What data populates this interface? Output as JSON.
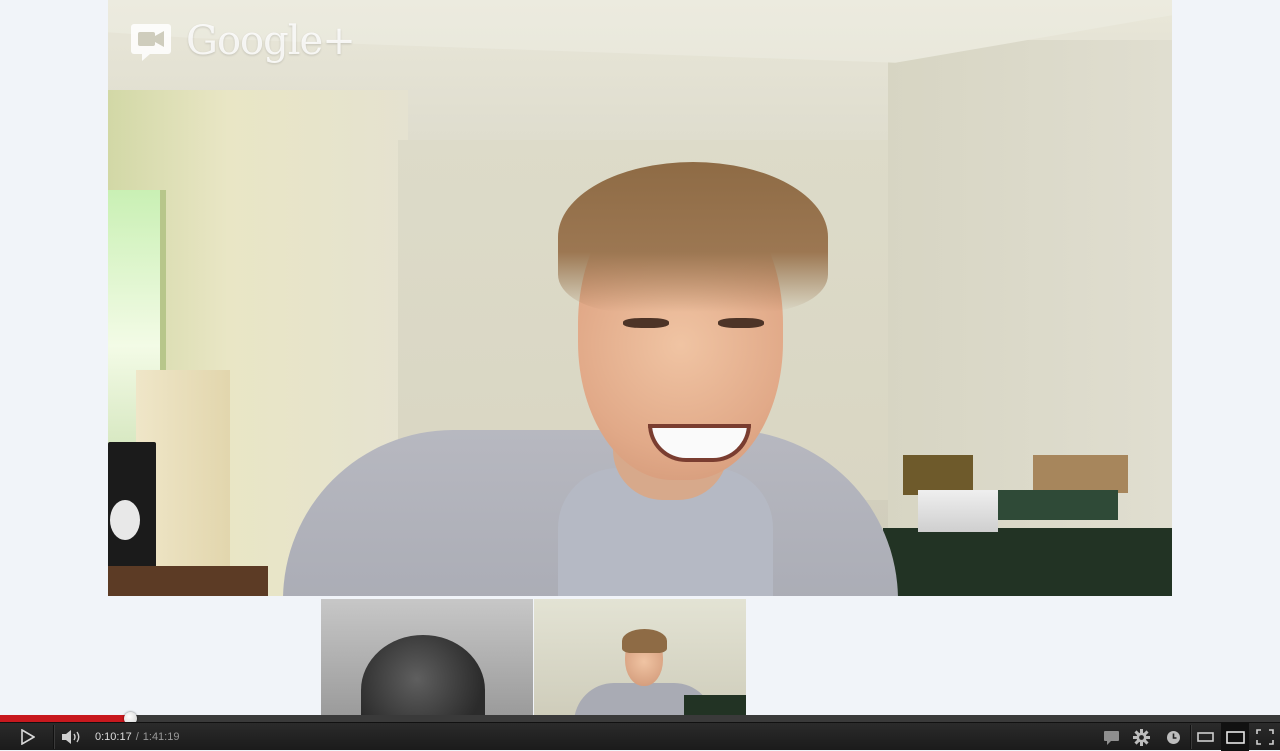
{
  "brand": {
    "name": "Google+",
    "camera_icon": "video-camera-icon"
  },
  "player": {
    "current_time": "0:10:17",
    "separator": "/",
    "duration": "1:41:19",
    "played_fraction": 0.1015,
    "loaded_fraction": 0.1015,
    "accent_color": "#c8181e"
  },
  "controls": {
    "play_icon": "play-icon",
    "volume_icon": "volume-icon",
    "captions_icon": "captions-icon",
    "settings_icon": "gear-icon",
    "watch_later_icon": "clock-icon",
    "small_player_icon": "small-player-icon",
    "large_player_icon": "large-player-icon",
    "fullscreen_icon": "fullscreen-icon"
  },
  "participants": [
    {
      "name": "participant-1"
    },
    {
      "name": "participant-2"
    }
  ]
}
